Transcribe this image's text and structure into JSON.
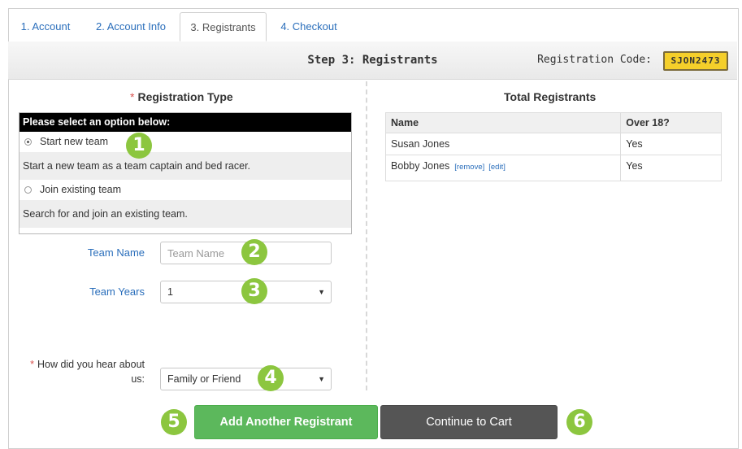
{
  "tabs": [
    {
      "label": "1. Account",
      "active": false
    },
    {
      "label": "2. Account Info",
      "active": false
    },
    {
      "label": "3. Registrants",
      "active": true
    },
    {
      "label": "4. Checkout",
      "active": false
    }
  ],
  "step_bar": {
    "title": "Step 3: Registrants",
    "code_label": "Registration Code:",
    "code_value": "SJON2473"
  },
  "registration_type": {
    "required_mark": "*",
    "title": "Registration Type",
    "header": "Please select an option below:",
    "options": [
      {
        "label": "Start new team",
        "selected": true,
        "description": "Start a new team as a team captain and bed racer."
      },
      {
        "label": "Join existing team",
        "selected": false,
        "description": "Search for and join an existing team."
      }
    ]
  },
  "form": {
    "team_name_label": "Team Name",
    "team_name_placeholder": "Team Name",
    "team_years_label": "Team Years",
    "team_years_value": "1",
    "hear_required_mark": "*",
    "hear_label_line1": "How did you hear about",
    "hear_label_line2": "us:",
    "hear_value": "Family or Friend"
  },
  "registrants": {
    "title": "Total Registrants",
    "columns": [
      "Name",
      "Over 18?"
    ],
    "rows": [
      {
        "name": "Susan Jones",
        "over18": "Yes",
        "remove": "",
        "edit": ""
      },
      {
        "name": "Bobby Jones",
        "over18": "Yes",
        "remove": "[remove]",
        "edit": "[edit]"
      }
    ]
  },
  "buttons": {
    "add_another": "Add Another Registrant",
    "continue": "Continue to Cart"
  },
  "markers": [
    "1",
    "2",
    "3",
    "4",
    "5",
    "6"
  ],
  "colors": {
    "accent_link": "#2a6ebb",
    "add_button": "#5cb85c",
    "continue_button": "#555555",
    "code_badge": "#f5cf2a",
    "marker": "#8cc63f",
    "required": "#d9534f"
  }
}
